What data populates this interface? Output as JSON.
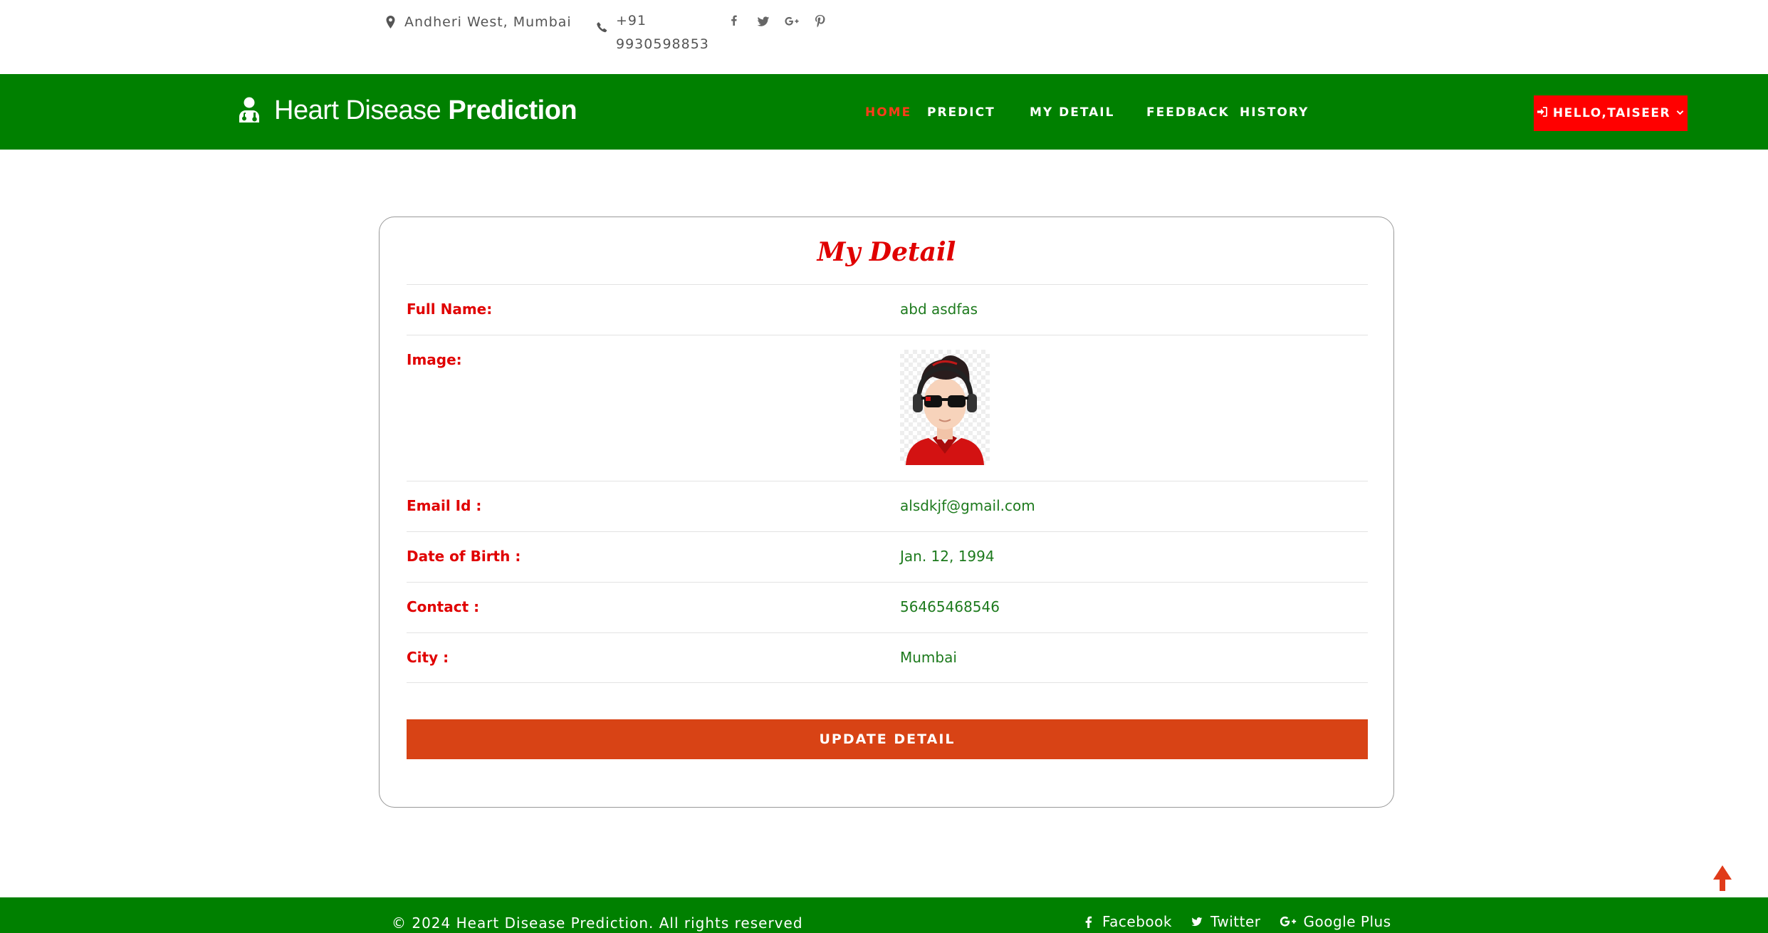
{
  "topbar": {
    "location": "Andheri West, Mumbai",
    "phone": "+91 9930598853",
    "social": [
      "facebook-icon",
      "twitter-icon",
      "google-plus-icon",
      "pinterest-icon"
    ]
  },
  "brand": {
    "name_light": "Heart Disease",
    "name_bold": "Prediction",
    "icon": "doctor-icon"
  },
  "nav": {
    "items": [
      {
        "label": "HOME",
        "active": true
      },
      {
        "label": "PREDICT",
        "active": false
      },
      {
        "label": "MY DETAIL",
        "active": false
      },
      {
        "label": "FEEDBACK",
        "active": false
      },
      {
        "label": "HISTORY",
        "active": false
      }
    ],
    "user_button": "HELLO,TAISEER",
    "user_button_icon": "sign-in-icon"
  },
  "card": {
    "title": "My Detail",
    "rows": [
      {
        "label": "Full Name:",
        "value": "abd asdfas"
      },
      {
        "label": "Image:",
        "value": ""
      },
      {
        "label": "Email Id :",
        "value": "alsdkjf@gmail.com"
      },
      {
        "label": "Date of Birth :",
        "value": "Jan. 12, 1994"
      },
      {
        "label": "Contact :",
        "value": "56465468546"
      },
      {
        "label": "City :",
        "value": "Mumbai"
      }
    ],
    "update_button": "UPDATE DETAIL"
  },
  "footer": {
    "copyright": "© 2024 Heart Disease Prediction. All rights reserved",
    "links": [
      "Facebook",
      "Twitter",
      "Google Plus"
    ]
  },
  "colors": {
    "nav_green": "#008000",
    "accent_red": "#ff0000",
    "button_orange": "#d84315",
    "value_green": "#1d7a1d"
  }
}
